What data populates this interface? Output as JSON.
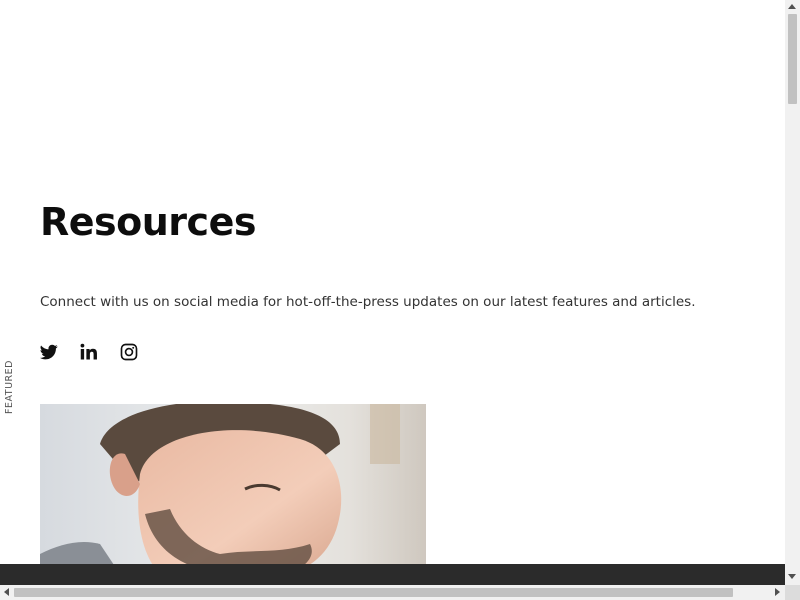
{
  "header": {
    "title": "Resources"
  },
  "intro": {
    "text": "Connect with us on social media for hot-off-the-press updates on our latest features and articles."
  },
  "social": {
    "items": [
      {
        "icon": "twitter-icon"
      },
      {
        "icon": "linkedin-icon"
      },
      {
        "icon": "instagram-icon"
      }
    ]
  },
  "featured": {
    "label": "FEATURED"
  },
  "colors": {
    "text": "#0d0d0d",
    "bottom_bar": "#2b2b2b",
    "scrollbar_track": "#f1f1f1",
    "scrollbar_thumb": "#c1c1c1"
  }
}
